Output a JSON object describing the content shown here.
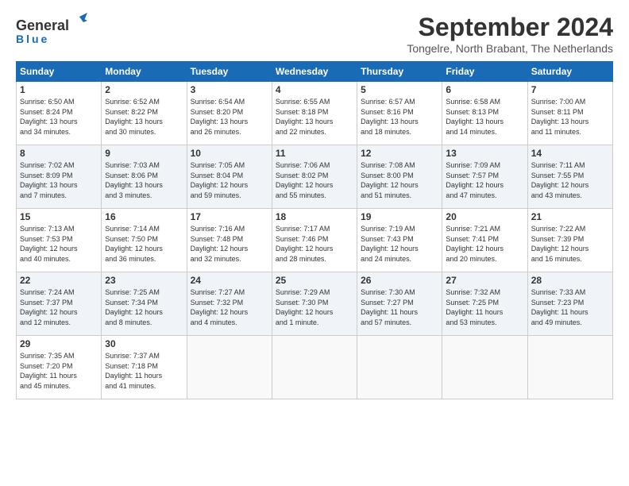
{
  "header": {
    "logo_general": "General",
    "logo_blue": "Blue",
    "month": "September 2024",
    "location": "Tongelre, North Brabant, The Netherlands"
  },
  "weekdays": [
    "Sunday",
    "Monday",
    "Tuesday",
    "Wednesday",
    "Thursday",
    "Friday",
    "Saturday"
  ],
  "weeks": [
    [
      {
        "day": "1",
        "info": "Sunrise: 6:50 AM\nSunset: 8:24 PM\nDaylight: 13 hours\nand 34 minutes."
      },
      {
        "day": "2",
        "info": "Sunrise: 6:52 AM\nSunset: 8:22 PM\nDaylight: 13 hours\nand 30 minutes."
      },
      {
        "day": "3",
        "info": "Sunrise: 6:54 AM\nSunset: 8:20 PM\nDaylight: 13 hours\nand 26 minutes."
      },
      {
        "day": "4",
        "info": "Sunrise: 6:55 AM\nSunset: 8:18 PM\nDaylight: 13 hours\nand 22 minutes."
      },
      {
        "day": "5",
        "info": "Sunrise: 6:57 AM\nSunset: 8:16 PM\nDaylight: 13 hours\nand 18 minutes."
      },
      {
        "day": "6",
        "info": "Sunrise: 6:58 AM\nSunset: 8:13 PM\nDaylight: 13 hours\nand 14 minutes."
      },
      {
        "day": "7",
        "info": "Sunrise: 7:00 AM\nSunset: 8:11 PM\nDaylight: 13 hours\nand 11 minutes."
      }
    ],
    [
      {
        "day": "8",
        "info": "Sunrise: 7:02 AM\nSunset: 8:09 PM\nDaylight: 13 hours\nand 7 minutes."
      },
      {
        "day": "9",
        "info": "Sunrise: 7:03 AM\nSunset: 8:06 PM\nDaylight: 13 hours\nand 3 minutes."
      },
      {
        "day": "10",
        "info": "Sunrise: 7:05 AM\nSunset: 8:04 PM\nDaylight: 12 hours\nand 59 minutes."
      },
      {
        "day": "11",
        "info": "Sunrise: 7:06 AM\nSunset: 8:02 PM\nDaylight: 12 hours\nand 55 minutes."
      },
      {
        "day": "12",
        "info": "Sunrise: 7:08 AM\nSunset: 8:00 PM\nDaylight: 12 hours\nand 51 minutes."
      },
      {
        "day": "13",
        "info": "Sunrise: 7:09 AM\nSunset: 7:57 PM\nDaylight: 12 hours\nand 47 minutes."
      },
      {
        "day": "14",
        "info": "Sunrise: 7:11 AM\nSunset: 7:55 PM\nDaylight: 12 hours\nand 43 minutes."
      }
    ],
    [
      {
        "day": "15",
        "info": "Sunrise: 7:13 AM\nSunset: 7:53 PM\nDaylight: 12 hours\nand 40 minutes."
      },
      {
        "day": "16",
        "info": "Sunrise: 7:14 AM\nSunset: 7:50 PM\nDaylight: 12 hours\nand 36 minutes."
      },
      {
        "day": "17",
        "info": "Sunrise: 7:16 AM\nSunset: 7:48 PM\nDaylight: 12 hours\nand 32 minutes."
      },
      {
        "day": "18",
        "info": "Sunrise: 7:17 AM\nSunset: 7:46 PM\nDaylight: 12 hours\nand 28 minutes."
      },
      {
        "day": "19",
        "info": "Sunrise: 7:19 AM\nSunset: 7:43 PM\nDaylight: 12 hours\nand 24 minutes."
      },
      {
        "day": "20",
        "info": "Sunrise: 7:21 AM\nSunset: 7:41 PM\nDaylight: 12 hours\nand 20 minutes."
      },
      {
        "day": "21",
        "info": "Sunrise: 7:22 AM\nSunset: 7:39 PM\nDaylight: 12 hours\nand 16 minutes."
      }
    ],
    [
      {
        "day": "22",
        "info": "Sunrise: 7:24 AM\nSunset: 7:37 PM\nDaylight: 12 hours\nand 12 minutes."
      },
      {
        "day": "23",
        "info": "Sunrise: 7:25 AM\nSunset: 7:34 PM\nDaylight: 12 hours\nand 8 minutes."
      },
      {
        "day": "24",
        "info": "Sunrise: 7:27 AM\nSunset: 7:32 PM\nDaylight: 12 hours\nand 4 minutes."
      },
      {
        "day": "25",
        "info": "Sunrise: 7:29 AM\nSunset: 7:30 PM\nDaylight: 12 hours\nand 1 minute."
      },
      {
        "day": "26",
        "info": "Sunrise: 7:30 AM\nSunset: 7:27 PM\nDaylight: 11 hours\nand 57 minutes."
      },
      {
        "day": "27",
        "info": "Sunrise: 7:32 AM\nSunset: 7:25 PM\nDaylight: 11 hours\nand 53 minutes."
      },
      {
        "day": "28",
        "info": "Sunrise: 7:33 AM\nSunset: 7:23 PM\nDaylight: 11 hours\nand 49 minutes."
      }
    ],
    [
      {
        "day": "29",
        "info": "Sunrise: 7:35 AM\nSunset: 7:20 PM\nDaylight: 11 hours\nand 45 minutes."
      },
      {
        "day": "30",
        "info": "Sunrise: 7:37 AM\nSunset: 7:18 PM\nDaylight: 11 hours\nand 41 minutes."
      },
      {
        "day": "",
        "info": ""
      },
      {
        "day": "",
        "info": ""
      },
      {
        "day": "",
        "info": ""
      },
      {
        "day": "",
        "info": ""
      },
      {
        "day": "",
        "info": ""
      }
    ]
  ]
}
